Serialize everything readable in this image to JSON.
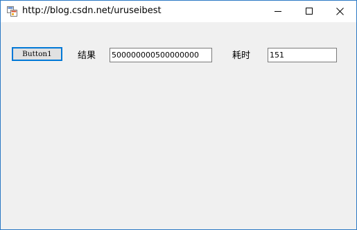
{
  "window": {
    "title": "http://blog.csdn.net/uruseibest",
    "icon": "form-app-icon"
  },
  "controls": {
    "button_label": "Button1",
    "result_label": "结果",
    "result_value": "500000000500000000",
    "time_label": "耗时",
    "time_value": "151"
  },
  "colors": {
    "accent": "#0078d7",
    "client_bg": "#f0f0f0"
  }
}
